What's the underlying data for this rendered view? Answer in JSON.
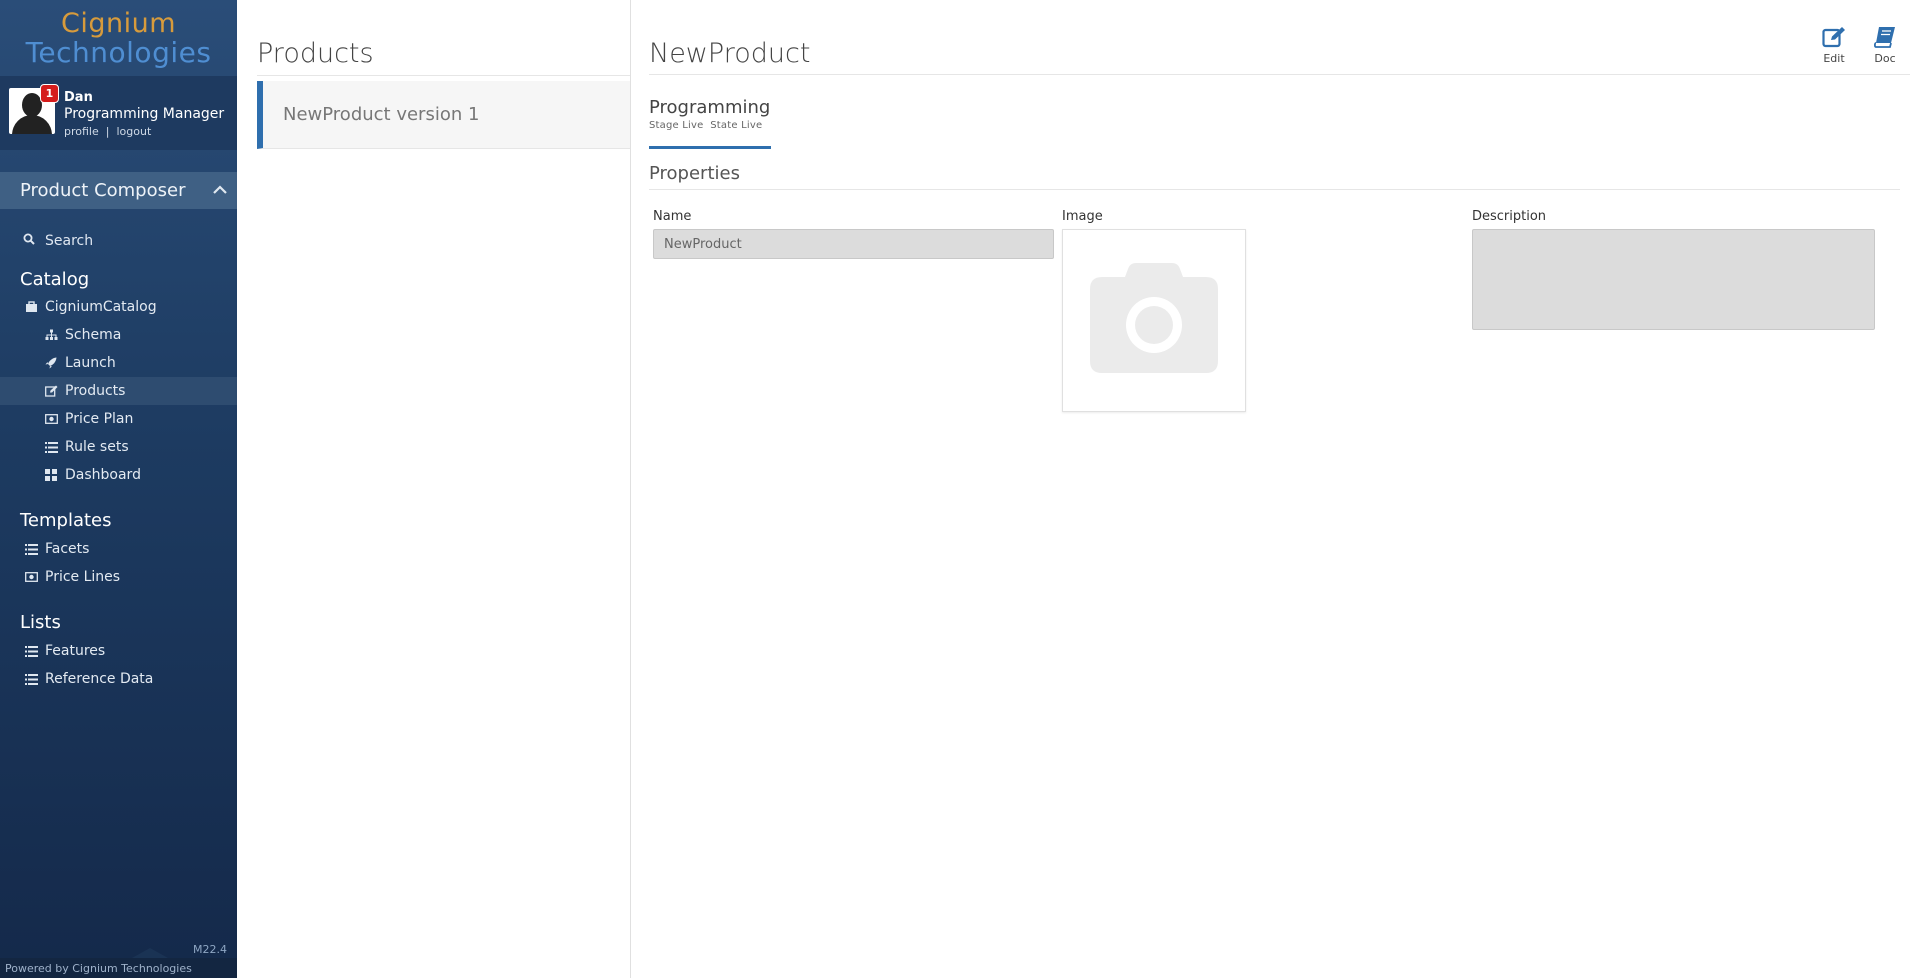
{
  "brand": {
    "line1": "Cignium",
    "line2": "Technologies"
  },
  "user": {
    "name": "Dan",
    "role": "Programming Manager",
    "notifications": "1",
    "profile_link": "profile",
    "separator": "|",
    "logout_link": "logout"
  },
  "sidebar": {
    "section": "Product Composer",
    "search": "Search",
    "catalog_title": "Catalog",
    "catalog_root": "CigniumCatalog",
    "catalog_items": [
      "Schema",
      "Launch",
      "Products",
      "Price Plan",
      "Rule sets",
      "Dashboard"
    ],
    "templates_title": "Templates",
    "template_items": [
      "Facets",
      "Price Lines"
    ],
    "lists_title": "Lists",
    "list_items": [
      "Features",
      "Reference Data"
    ],
    "version": "M22.4",
    "powered_by": "Powered by Cignium Technologies"
  },
  "list_panel": {
    "title": "Products",
    "items": [
      "NewProduct version 1"
    ]
  },
  "detail": {
    "title": "NewProduct",
    "toolbar": {
      "edit_label": "Edit",
      "doc_label": "Doc"
    },
    "tab": {
      "label": "Programming",
      "sub": "Stage Live  State Live"
    },
    "properties_title": "Properties",
    "fields": {
      "name_label": "Name",
      "name_value": "NewProduct",
      "image_label": "Image",
      "description_label": "Description",
      "description_value": ""
    }
  },
  "colors": {
    "accent": "#2f6fae",
    "sidebar_top": "#2a4d78",
    "sidebar_bottom": "#14294a",
    "badge": "#d51c1c",
    "logo_orange": "#d79b3c",
    "logo_blue": "#4f8ed2"
  },
  "icons": {
    "search": "search-icon",
    "catalog": "briefcase-icon",
    "schema": "sitemap-icon",
    "launch": "rocket-icon",
    "products": "edit-icon",
    "price_plan": "money-icon",
    "rule_sets": "list-icon",
    "dashboard": "dashboard-icon",
    "edit": "edit-icon",
    "doc": "book-icon",
    "image_placeholder": "camera-icon"
  }
}
